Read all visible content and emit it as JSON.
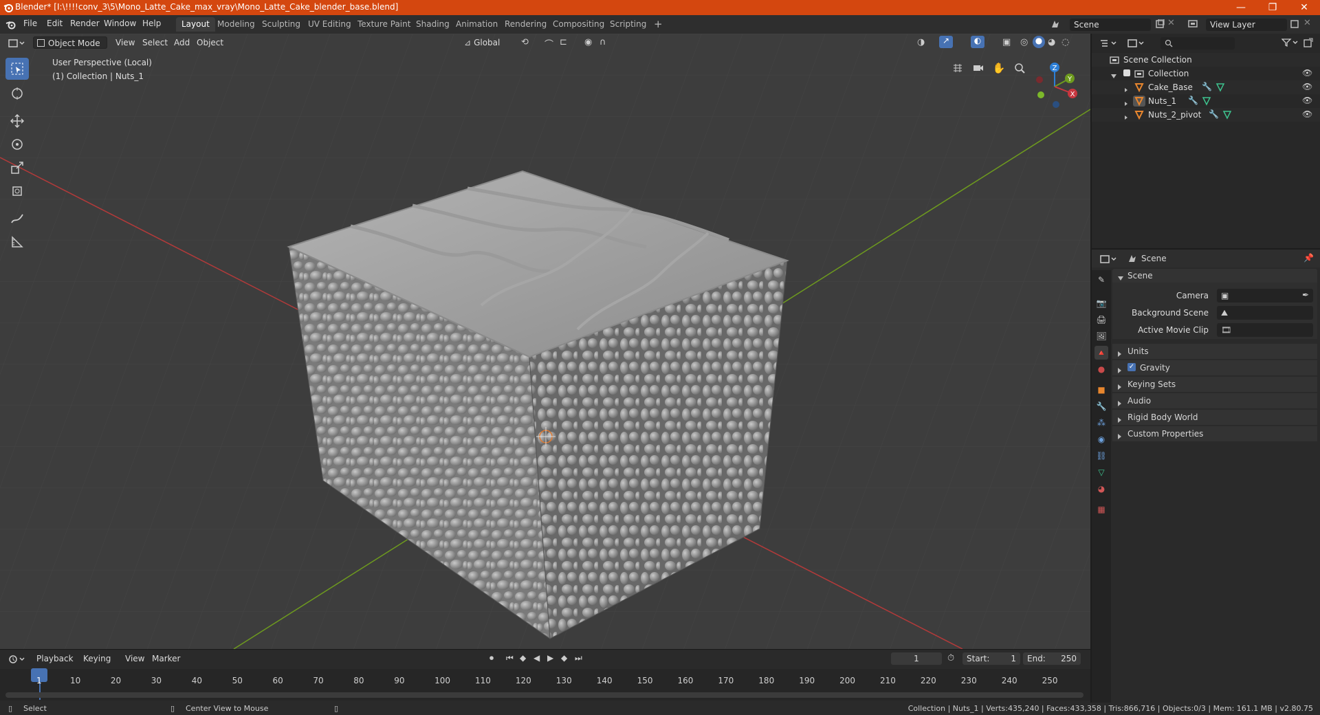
{
  "titlebar": {
    "title": "Blender* [I:\\!!!!conv_3\\5\\Mono_Latte_Cake_max_vray\\Mono_Latte_Cake_blender_base.blend]",
    "minimize": "—",
    "maximize": "❐",
    "close": "✕"
  },
  "menu": {
    "items": [
      "File",
      "Edit",
      "Render",
      "Window",
      "Help"
    ]
  },
  "workspaces": [
    "Layout",
    "Modeling",
    "Sculpting",
    "UV Editing",
    "Texture Paint",
    "Shading",
    "Animation",
    "Rendering",
    "Compositing",
    "Scripting"
  ],
  "workspace_add": "+",
  "scene_field": "Scene",
  "viewlayer_field": "View Layer",
  "viewport": {
    "mode": "Object Mode",
    "menus": [
      "View",
      "Select",
      "Add",
      "Object"
    ],
    "orientation": "Global",
    "perspective_label": "User Perspective (Local)",
    "collection_label": "(1) Collection | Nuts_1",
    "gizmo": {
      "z": "Z",
      "y": "Y",
      "x": "X"
    }
  },
  "timeline": {
    "menus": [
      "Playback",
      "Keying",
      "View",
      "Marker"
    ],
    "current_frame": "1",
    "start_label": "Start:",
    "start_value": "1",
    "end_label": "End:",
    "end_value": "250",
    "ticks": [
      "1",
      "10",
      "20",
      "30",
      "40",
      "50",
      "60",
      "70",
      "80",
      "90",
      "100",
      "110",
      "120",
      "130",
      "140",
      "150",
      "160",
      "170",
      "180",
      "190",
      "200",
      "210",
      "220",
      "230",
      "240",
      "250"
    ]
  },
  "statusbar": {
    "left_action": "Select",
    "mid_action": "Center View to Mouse",
    "stats": "Collection | Nuts_1 | Verts:435,240 | Faces:433,358 | Tris:866,716 | Objects:0/3 | Mem: 161.1 MB | v2.80.75"
  },
  "outliner": {
    "root": "Scene Collection",
    "collection": "Collection",
    "objects": [
      "Cake_Base",
      "Nuts_1",
      "Nuts_2_pivot"
    ]
  },
  "properties": {
    "context": "Scene",
    "panel_title": "Scene",
    "camera_label": "Camera",
    "background_label": "Background Scene",
    "clip_label": "Active Movie Clip",
    "sections": [
      "Units",
      "Gravity",
      "Keying Sets",
      "Audio",
      "Rigid Body World",
      "Custom Properties"
    ]
  },
  "colors": {
    "titlebar": "#d4470f",
    "accent": "#4772b3",
    "x_axis": "#c8363f",
    "y_axis": "#6e9b1e",
    "z_axis": "#2d7fd6"
  }
}
